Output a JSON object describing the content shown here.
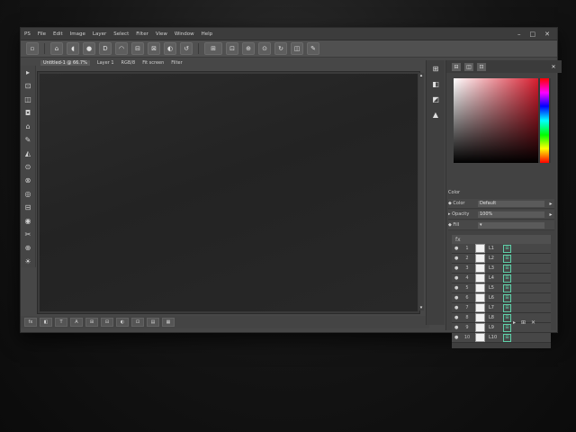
{
  "menubar": {
    "items": [
      "PS",
      "File",
      "Edit",
      "Image",
      "Layer",
      "Select",
      "Filter",
      "View",
      "Window",
      "Help"
    ],
    "controls": [
      "–",
      "□",
      "✕"
    ]
  },
  "options_bar": {
    "buttons": [
      "▫",
      "⌂",
      "◖",
      "●",
      "D",
      "◠",
      "⊟",
      "⊠",
      "◐",
      "↺",
      "⊞",
      "⊡",
      "⊕",
      "⊙",
      "↻",
      "◫",
      "✎"
    ]
  },
  "document_tabs": [
    "Untitled-1 @ 66.7%",
    "Layer 1",
    "RGB/8",
    "Fit screen",
    "Filter"
  ],
  "toolbox": {
    "icons": [
      "▸",
      "⊡",
      "◫",
      "◘",
      "⌂",
      "✎",
      "◭",
      "⊙",
      "⊗",
      "◎",
      "⊟",
      "◉",
      "✂",
      "⊕",
      "☀"
    ]
  },
  "status_bar": {
    "buttons": [
      "fx",
      "◧",
      "T",
      "A",
      "⊞",
      "⊟",
      "◐",
      "⊡",
      "▤",
      "▦"
    ]
  },
  "right_dock": {
    "icons": [
      "⊞",
      "◧",
      "◩",
      "▲"
    ]
  },
  "color_panel": {
    "tabs": [
      "⊟",
      "◫",
      "⊡"
    ],
    "close": "✕",
    "section_label": "Color"
  },
  "properties": [
    {
      "key": "◆ Color",
      "value": "Default",
      "btn": "▸"
    },
    {
      "key": "▸ Opacity",
      "value": "100%",
      "btn": "▸"
    },
    {
      "key": "◆ Fill",
      "value": "▾",
      "btn": ""
    }
  ],
  "layers": {
    "header": "fx",
    "rows": [
      {
        "eye": "●",
        "num": "1",
        "name": "L1",
        "icon": "⊞"
      },
      {
        "eye": "●",
        "num": "2",
        "name": "L2",
        "icon": "⊞"
      },
      {
        "eye": "●",
        "num": "3",
        "name": "L3",
        "icon": "⊞"
      },
      {
        "eye": "●",
        "num": "4",
        "name": "L4",
        "icon": "⊞"
      },
      {
        "eye": "●",
        "num": "5",
        "name": "L5",
        "icon": "⊞"
      },
      {
        "eye": "●",
        "num": "6",
        "name": "L6",
        "icon": "⊞"
      },
      {
        "eye": "●",
        "num": "7",
        "name": "L7",
        "icon": "⊞"
      },
      {
        "eye": "●",
        "num": "8",
        "name": "L8",
        "icon": "⊞"
      },
      {
        "eye": "●",
        "num": "9",
        "name": "L9",
        "icon": "⊞"
      },
      {
        "eye": "●",
        "num": "10",
        "name": "L10",
        "icon": "⊞"
      }
    ],
    "footer": [
      "▸",
      "⊞",
      "✕"
    ]
  }
}
